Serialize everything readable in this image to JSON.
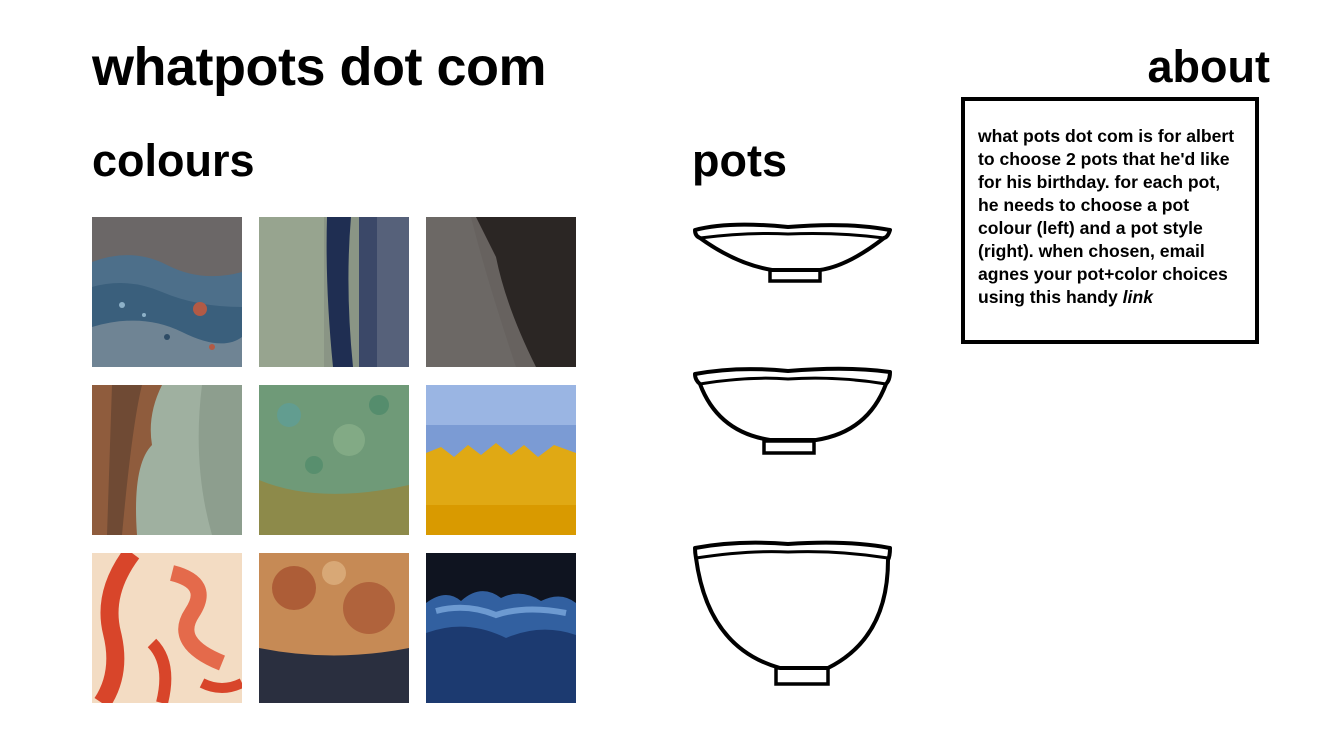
{
  "site": {
    "title": "whatpots dot com"
  },
  "colours": {
    "heading": "colours",
    "swatches": [
      {
        "name": "swatch-1",
        "palette": [
          "#5d5a5c",
          "#3a5f7c",
          "#6c7f8c",
          "#b25a45"
        ]
      },
      {
        "name": "swatch-2",
        "palette": [
          "#7f8a80",
          "#1f2e52",
          "#9aa58d",
          "#3b4868"
        ]
      },
      {
        "name": "swatch-3",
        "palette": [
          "#4e4b48",
          "#2b2624",
          "#6c6865",
          "#3a3533"
        ]
      },
      {
        "name": "swatch-4",
        "palette": [
          "#8f5c3d",
          "#9aab9a",
          "#a5b6a6",
          "#7a8a80"
        ]
      },
      {
        "name": "swatch-5",
        "palette": [
          "#4f8a6a",
          "#8ab08a",
          "#8d8a4a",
          "#5aa0a0"
        ]
      },
      {
        "name": "swatch-6",
        "palette": [
          "#6d8ec9",
          "#9ab5e3",
          "#e0a914",
          "#d99a00"
        ]
      },
      {
        "name": "swatch-7",
        "palette": [
          "#f1d9c1",
          "#d8452a",
          "#e46a4b",
          "#f7e4d0"
        ]
      },
      {
        "name": "swatch-8",
        "palette": [
          "#c6844f",
          "#a24a2b",
          "#2a2f3f",
          "#d8a876"
        ]
      },
      {
        "name": "swatch-9",
        "palette": [
          "#0f1420",
          "#3260a0",
          "#6d9ad1",
          "#1c3a70"
        ]
      }
    ]
  },
  "pots": {
    "heading": "pots",
    "styles": [
      "shallow-bowl",
      "medium-bowl",
      "deep-bowl"
    ]
  },
  "about": {
    "heading": "about",
    "text": "what pots dot com is for albert to choose 2 pots that he'd like for his birthday. for each pot, he needs to choose a pot colour (left) and a pot style (right). when chosen, email agnes your pot+color choices using this handy",
    "link_label": "link"
  },
  "colors": {
    "text": "#000000",
    "background": "#ffffff"
  }
}
